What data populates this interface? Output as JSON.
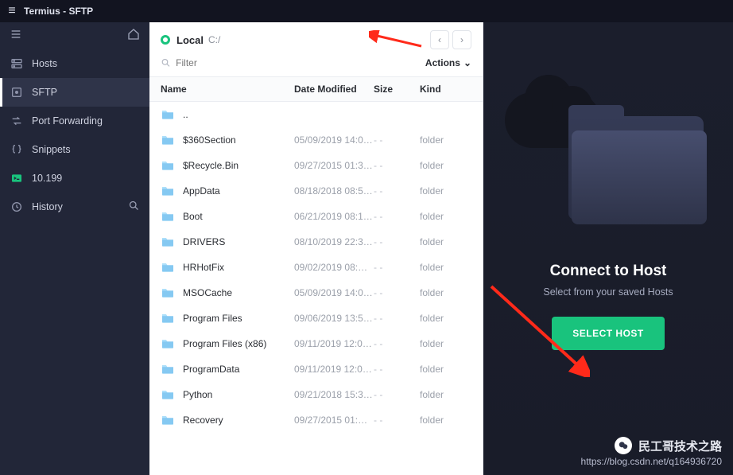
{
  "app": {
    "title": "Termius - SFTP"
  },
  "sidebar": {
    "items": [
      {
        "label": "Hosts",
        "icon": "server"
      },
      {
        "label": "SFTP",
        "icon": "sftp"
      },
      {
        "label": "Port Forwarding",
        "icon": "arrows"
      },
      {
        "label": "Snippets",
        "icon": "braces"
      },
      {
        "label": "10.199",
        "icon": "prompt"
      },
      {
        "label": "History",
        "icon": "clock"
      }
    ],
    "active": 1
  },
  "filepane": {
    "location_label": "Local",
    "path": "C:/",
    "filter_placeholder": "Filter",
    "actions_label": "Actions",
    "columns": {
      "name": "Name",
      "date": "Date Modified",
      "size": "Size",
      "kind": "Kind"
    },
    "rows": [
      {
        "name": "..",
        "date": "",
        "size": "",
        "kind": ""
      },
      {
        "name": "$360Section",
        "date": "05/09/2019 14:0…",
        "size": "- -",
        "kind": "folder"
      },
      {
        "name": "$Recycle.Bin",
        "date": "09/27/2015 01:3…",
        "size": "- -",
        "kind": "folder"
      },
      {
        "name": "AppData",
        "date": "08/18/2018 08:5…",
        "size": "- -",
        "kind": "folder"
      },
      {
        "name": "Boot",
        "date": "06/21/2019 08:1…",
        "size": "- -",
        "kind": "folder"
      },
      {
        "name": "DRIVERS",
        "date": "08/10/2019 22:3…",
        "size": "- -",
        "kind": "folder"
      },
      {
        "name": "HRHotFix",
        "date": "09/02/2019 08:…",
        "size": "- -",
        "kind": "folder"
      },
      {
        "name": "MSOCache",
        "date": "05/09/2019 14:0…",
        "size": "- -",
        "kind": "folder"
      },
      {
        "name": "Program Files",
        "date": "09/06/2019 13:5…",
        "size": "- -",
        "kind": "folder"
      },
      {
        "name": "Program Files (x86)",
        "date": "09/11/2019 12:0…",
        "size": "- -",
        "kind": "folder"
      },
      {
        "name": "ProgramData",
        "date": "09/11/2019 12:0…",
        "size": "- -",
        "kind": "folder"
      },
      {
        "name": "Python",
        "date": "09/21/2018 15:31…",
        "size": "- -",
        "kind": "folder"
      },
      {
        "name": "Recovery",
        "date": "09/27/2015 01:…",
        "size": "- -",
        "kind": "folder"
      }
    ]
  },
  "hostpane": {
    "title": "Connect to Host",
    "subtitle": "Select from your saved Hosts",
    "button": "SELECT HOST"
  },
  "watermark": {
    "text": "民工哥技术之路",
    "url": "https://blog.csdn.net/q164936720"
  }
}
